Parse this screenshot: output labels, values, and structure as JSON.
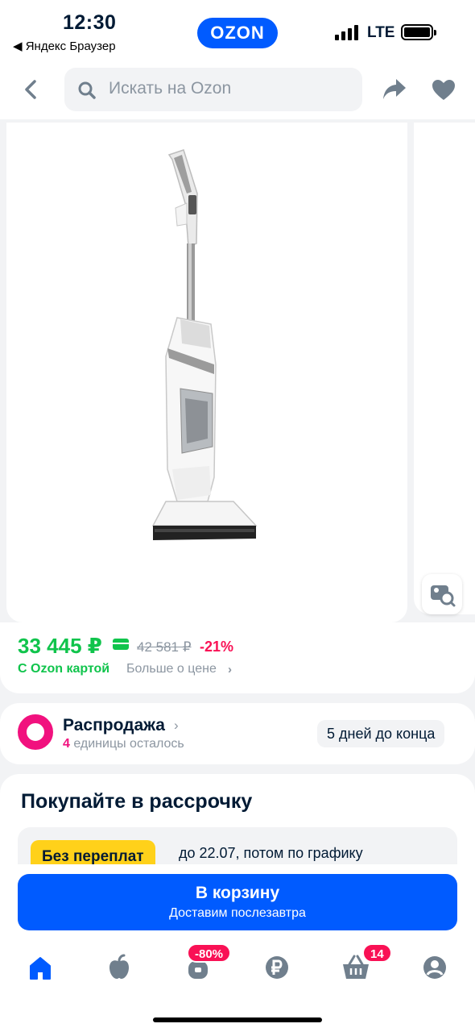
{
  "status_bar": {
    "time": "12:30",
    "back_app": "◀ Яндекс Браузер",
    "brand": "OZON",
    "network": "LTE"
  },
  "header": {
    "search_placeholder": "Искать на Ozon",
    "icons": [
      "chevron-left-icon",
      "search-icon",
      "share-icon",
      "heart-icon"
    ]
  },
  "product": {
    "image": "cordless-vacuum-cleaner",
    "price": "33 445 ₽",
    "old_price": "42 581 ₽",
    "discount": "-21%",
    "card_note": "С Ozon картой",
    "more_price": "Больше о цене",
    "more_price_arrow": "›"
  },
  "sale": {
    "title": "Распродажа",
    "title_arrow": "›",
    "count": "4",
    "count_text": " единицы осталось",
    "days_left": "5 дней до конца"
  },
  "installment": {
    "title": "Покупайте в рассрочку",
    "badge": "Без переплат",
    "text": "до 22.07, потом по графику"
  },
  "cart": {
    "label": "В корзину",
    "delivery": "Доставим послезавтра"
  },
  "tabbar": {
    "discount_badge": "-80%",
    "cart_badge": "14",
    "accent": "#005bff"
  }
}
